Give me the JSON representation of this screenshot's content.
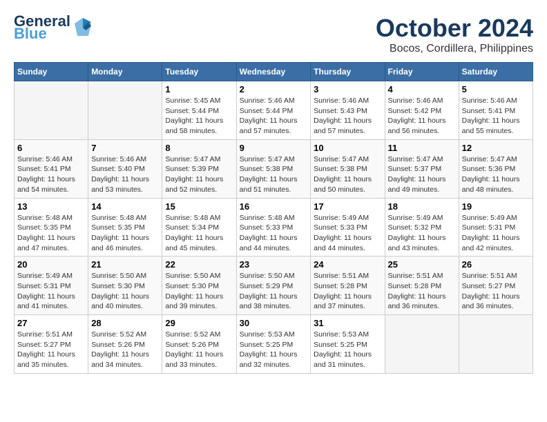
{
  "logo": {
    "line1": "General",
    "line2": "Blue"
  },
  "title": "October 2024",
  "location": "Bocos, Cordillera, Philippines",
  "weekdays": [
    "Sunday",
    "Monday",
    "Tuesday",
    "Wednesday",
    "Thursday",
    "Friday",
    "Saturday"
  ],
  "weeks": [
    [
      {
        "day": "",
        "info": ""
      },
      {
        "day": "",
        "info": ""
      },
      {
        "day": "1",
        "info": "Sunrise: 5:45 AM\nSunset: 5:44 PM\nDaylight: 11 hours and 58 minutes."
      },
      {
        "day": "2",
        "info": "Sunrise: 5:46 AM\nSunset: 5:44 PM\nDaylight: 11 hours and 57 minutes."
      },
      {
        "day": "3",
        "info": "Sunrise: 5:46 AM\nSunset: 5:43 PM\nDaylight: 11 hours and 57 minutes."
      },
      {
        "day": "4",
        "info": "Sunrise: 5:46 AM\nSunset: 5:42 PM\nDaylight: 11 hours and 56 minutes."
      },
      {
        "day": "5",
        "info": "Sunrise: 5:46 AM\nSunset: 5:41 PM\nDaylight: 11 hours and 55 minutes."
      }
    ],
    [
      {
        "day": "6",
        "info": "Sunrise: 5:46 AM\nSunset: 5:41 PM\nDaylight: 11 hours and 54 minutes."
      },
      {
        "day": "7",
        "info": "Sunrise: 5:46 AM\nSunset: 5:40 PM\nDaylight: 11 hours and 53 minutes."
      },
      {
        "day": "8",
        "info": "Sunrise: 5:47 AM\nSunset: 5:39 PM\nDaylight: 11 hours and 52 minutes."
      },
      {
        "day": "9",
        "info": "Sunrise: 5:47 AM\nSunset: 5:38 PM\nDaylight: 11 hours and 51 minutes."
      },
      {
        "day": "10",
        "info": "Sunrise: 5:47 AM\nSunset: 5:38 PM\nDaylight: 11 hours and 50 minutes."
      },
      {
        "day": "11",
        "info": "Sunrise: 5:47 AM\nSunset: 5:37 PM\nDaylight: 11 hours and 49 minutes."
      },
      {
        "day": "12",
        "info": "Sunrise: 5:47 AM\nSunset: 5:36 PM\nDaylight: 11 hours and 48 minutes."
      }
    ],
    [
      {
        "day": "13",
        "info": "Sunrise: 5:48 AM\nSunset: 5:35 PM\nDaylight: 11 hours and 47 minutes."
      },
      {
        "day": "14",
        "info": "Sunrise: 5:48 AM\nSunset: 5:35 PM\nDaylight: 11 hours and 46 minutes."
      },
      {
        "day": "15",
        "info": "Sunrise: 5:48 AM\nSunset: 5:34 PM\nDaylight: 11 hours and 45 minutes."
      },
      {
        "day": "16",
        "info": "Sunrise: 5:48 AM\nSunset: 5:33 PM\nDaylight: 11 hours and 44 minutes."
      },
      {
        "day": "17",
        "info": "Sunrise: 5:49 AM\nSunset: 5:33 PM\nDaylight: 11 hours and 44 minutes."
      },
      {
        "day": "18",
        "info": "Sunrise: 5:49 AM\nSunset: 5:32 PM\nDaylight: 11 hours and 43 minutes."
      },
      {
        "day": "19",
        "info": "Sunrise: 5:49 AM\nSunset: 5:31 PM\nDaylight: 11 hours and 42 minutes."
      }
    ],
    [
      {
        "day": "20",
        "info": "Sunrise: 5:49 AM\nSunset: 5:31 PM\nDaylight: 11 hours and 41 minutes."
      },
      {
        "day": "21",
        "info": "Sunrise: 5:50 AM\nSunset: 5:30 PM\nDaylight: 11 hours and 40 minutes."
      },
      {
        "day": "22",
        "info": "Sunrise: 5:50 AM\nSunset: 5:30 PM\nDaylight: 11 hours and 39 minutes."
      },
      {
        "day": "23",
        "info": "Sunrise: 5:50 AM\nSunset: 5:29 PM\nDaylight: 11 hours and 38 minutes."
      },
      {
        "day": "24",
        "info": "Sunrise: 5:51 AM\nSunset: 5:28 PM\nDaylight: 11 hours and 37 minutes."
      },
      {
        "day": "25",
        "info": "Sunrise: 5:51 AM\nSunset: 5:28 PM\nDaylight: 11 hours and 36 minutes."
      },
      {
        "day": "26",
        "info": "Sunrise: 5:51 AM\nSunset: 5:27 PM\nDaylight: 11 hours and 36 minutes."
      }
    ],
    [
      {
        "day": "27",
        "info": "Sunrise: 5:51 AM\nSunset: 5:27 PM\nDaylight: 11 hours and 35 minutes."
      },
      {
        "day": "28",
        "info": "Sunrise: 5:52 AM\nSunset: 5:26 PM\nDaylight: 11 hours and 34 minutes."
      },
      {
        "day": "29",
        "info": "Sunrise: 5:52 AM\nSunset: 5:26 PM\nDaylight: 11 hours and 33 minutes."
      },
      {
        "day": "30",
        "info": "Sunrise: 5:53 AM\nSunset: 5:25 PM\nDaylight: 11 hours and 32 minutes."
      },
      {
        "day": "31",
        "info": "Sunrise: 5:53 AM\nSunset: 5:25 PM\nDaylight: 11 hours and 31 minutes."
      },
      {
        "day": "",
        "info": ""
      },
      {
        "day": "",
        "info": ""
      }
    ]
  ]
}
